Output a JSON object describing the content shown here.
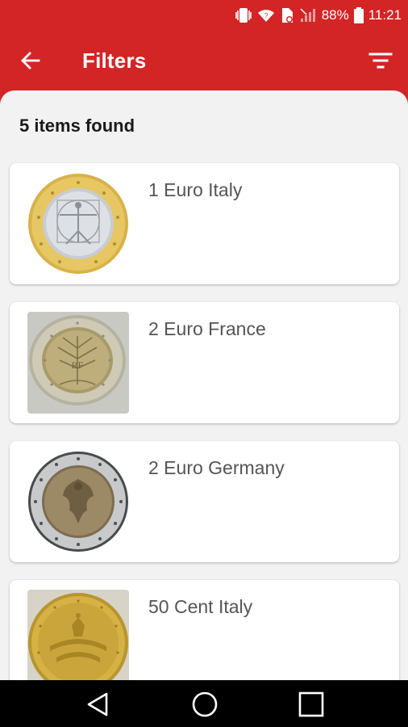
{
  "status_bar": {
    "battery": "88%",
    "time": "11:21"
  },
  "app_bar": {
    "title": "Filters"
  },
  "results": {
    "count_text": "5 items found",
    "items": [
      {
        "label": "1 Euro Italy"
      },
      {
        "label": "2 Euro France"
      },
      {
        "label": "2 Euro Germany"
      },
      {
        "label": "50 Cent Italy"
      }
    ]
  },
  "colors": {
    "primary": "#d32426",
    "background": "#f2f2f2",
    "card": "#ffffff",
    "text_secondary": "#555555"
  }
}
